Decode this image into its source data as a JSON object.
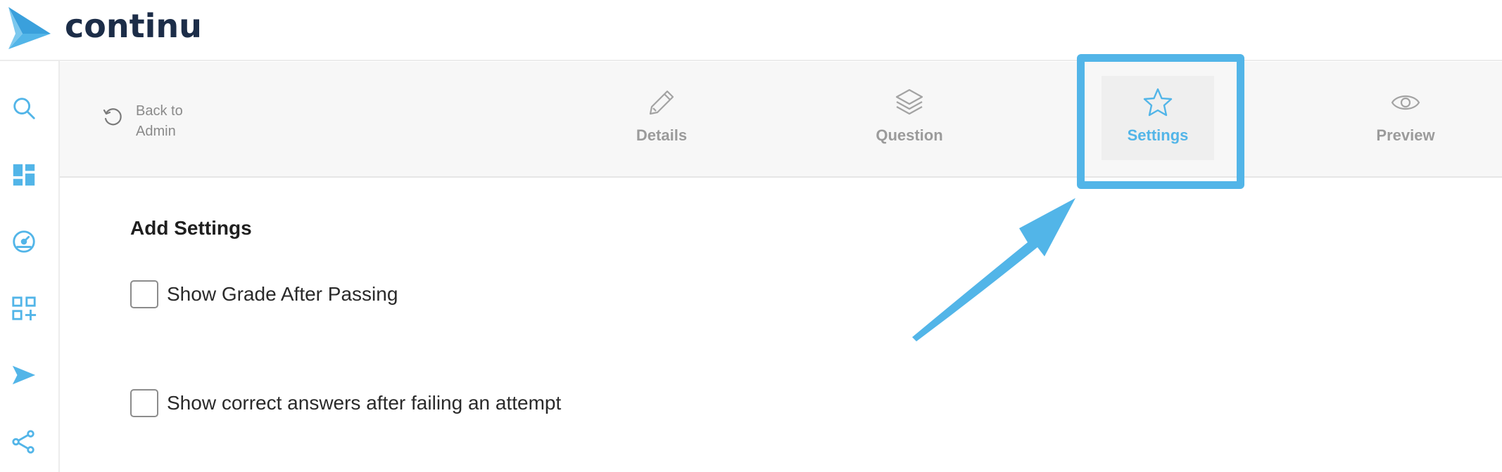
{
  "brand": {
    "name": "continu",
    "color": "#1c2d48",
    "accent": "#52b5e8"
  },
  "sidebar": {
    "items": [
      {
        "icon": "search-icon"
      },
      {
        "icon": "dashboard-icon"
      },
      {
        "icon": "gauge-icon"
      },
      {
        "icon": "add-widget-icon"
      },
      {
        "icon": "send-icon"
      },
      {
        "icon": "share-icon"
      }
    ]
  },
  "tabbar": {
    "back_label": "Back to Admin",
    "tabs": [
      {
        "label": "Details",
        "icon": "pencil-icon",
        "active": false
      },
      {
        "label": "Question",
        "icon": "layers-icon",
        "active": false
      },
      {
        "label": "Settings",
        "icon": "star-icon",
        "active": true
      },
      {
        "label": "Preview",
        "icon": "eye-icon",
        "active": false
      }
    ]
  },
  "main": {
    "title": "Add Settings",
    "options": [
      {
        "label": "Show Grade After Passing",
        "checked": false
      },
      {
        "label": "Show correct answers after failing an attempt",
        "checked": false
      }
    ]
  }
}
